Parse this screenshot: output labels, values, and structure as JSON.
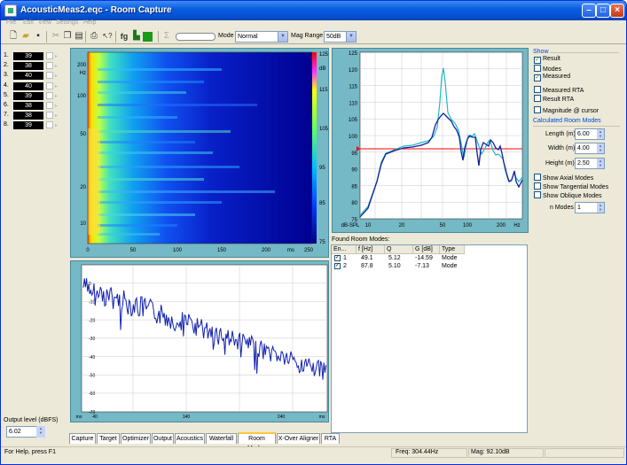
{
  "window": {
    "title": "AcousticMeas2.eqc - Room Capture"
  },
  "menu": [
    "File",
    "Edit",
    "View",
    "Settings",
    "Help"
  ],
  "toolbar": {
    "mode_label": "Mode",
    "mode_value": "Normal",
    "mag_range_label": "Mag Range",
    "mag_range_value": "50dB"
  },
  "channels": [
    {
      "num": "1.",
      "value": "39"
    },
    {
      "num": "2.",
      "value": "38"
    },
    {
      "num": "3.",
      "value": "40"
    },
    {
      "num": "4.",
      "value": "40"
    },
    {
      "num": "5.",
      "value": "39"
    },
    {
      "num": "6.",
      "value": "38"
    },
    {
      "num": "7.",
      "value": "38"
    },
    {
      "num": "8.",
      "value": "39"
    }
  ],
  "output": {
    "label": "Output level (dBFS)",
    "value": "6.02"
  },
  "waterfall": {
    "y_ticks": [
      "200",
      "Hz",
      "100",
      "50",
      "20",
      "10"
    ],
    "x_ticks": [
      "0",
      "50",
      "100",
      "150",
      "200",
      "ms",
      "250"
    ],
    "colorbar_ticks": [
      "125",
      "dB",
      "115",
      "105",
      "95",
      "85",
      "75"
    ]
  },
  "freq_plot": {
    "y_ticks": [
      "125",
      "120",
      "115",
      "110",
      "105",
      "100",
      "95",
      "90",
      "85",
      "80",
      "75"
    ],
    "x_ticks": [
      "dB-SPL",
      "10",
      "20",
      "50",
      "100",
      "200",
      "Hz"
    ],
    "colors": {
      "result": "#20b8c8",
      "measured": "#10209a",
      "target": "#ff0000"
    }
  },
  "time_plot": {
    "y_ticks": [
      "0",
      "-10",
      "-20",
      "-30",
      "-40",
      "-50",
      "-60",
      "-70"
    ],
    "x_ticks": [
      "ms",
      "40",
      "140",
      "240",
      "ms"
    ]
  },
  "show": {
    "group": "Show",
    "options": [
      {
        "label": "Result",
        "checked": true
      },
      {
        "label": "Modes",
        "checked": false
      },
      {
        "label": "Measured",
        "checked": true
      },
      {
        "label": "Measured RTA",
        "checked": false
      },
      {
        "label": "Result RTA",
        "checked": false
      },
      {
        "label": "Magnitude @ cursor",
        "checked": false
      }
    ]
  },
  "room_modes": {
    "group": "Calculated Room Modes",
    "length_label": "Length (m)",
    "length": "6.00",
    "width_label": "Width (m)",
    "width": "4.00",
    "height_label": "Height (m)",
    "height": "2.50",
    "axial": "Show Axial Modes",
    "tangential": "Show Tangential Modes",
    "oblique": "Show Oblique Modes",
    "nmodes_label": "n Modes",
    "nmodes": "1"
  },
  "found_modes": {
    "label": "Found Room Modes:",
    "columns": [
      "En...",
      "f [Hz]",
      "Q",
      "G [dB]",
      "Type"
    ],
    "rows": [
      {
        "en": "1",
        "f": "49.1",
        "q": "5.12",
        "g": "-14.59",
        "type": "Mode"
      },
      {
        "en": "2",
        "f": "87.8",
        "q": "5.10",
        "g": "-7.13",
        "type": "Mode"
      }
    ]
  },
  "tabs": [
    "Capture",
    "Target",
    "Optimizer",
    "Output",
    "Acoustics",
    "Waterfall",
    "Room Modes",
    "X-Over Aligner",
    "RTA"
  ],
  "active_tab": "Room Modes",
  "status": {
    "help": "For Help, press F1",
    "freq": "Freq: 304.44Hz",
    "mag": "Mag: 92.10dB"
  }
}
